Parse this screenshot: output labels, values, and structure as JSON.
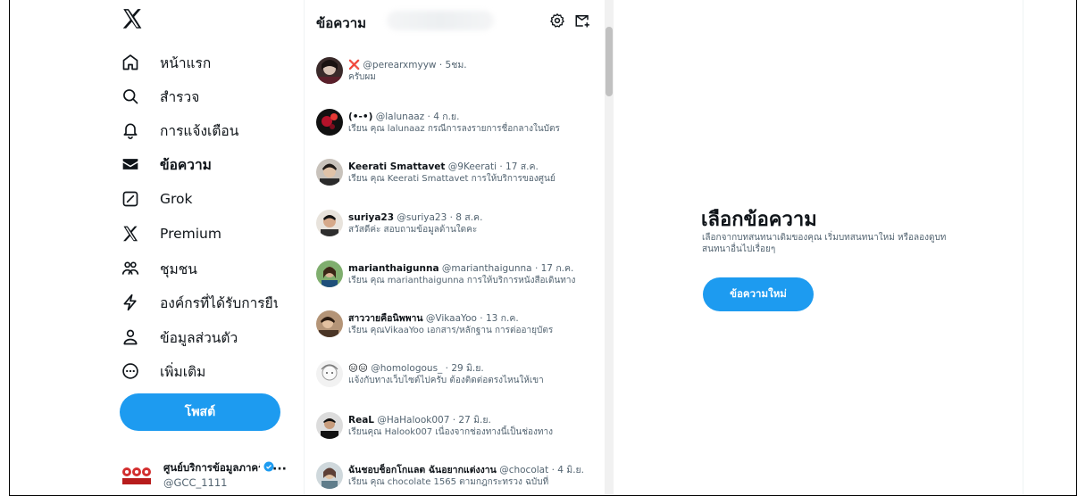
{
  "sidebar": {
    "logo": "x-logo-icon",
    "items": [
      {
        "label": "หน้าแรก",
        "icon": "home-icon"
      },
      {
        "label": "สำรวจ",
        "icon": "search-icon"
      },
      {
        "label": "การแจ้งเตือน",
        "icon": "bell-icon"
      },
      {
        "label": "ข้อความ",
        "icon": "envelope-icon",
        "active": true
      },
      {
        "label": "Grok",
        "icon": "grok-icon"
      },
      {
        "label": "Premium",
        "icon": "x-logo-icon"
      },
      {
        "label": "ชุมชน",
        "icon": "community-icon"
      },
      {
        "label": "องค์กรที่ได้รับการยืนยัน",
        "icon": "lightning-icon"
      },
      {
        "label": "ข้อมูลส่วนตัว",
        "icon": "profile-icon"
      },
      {
        "label": "เพิ่มเติม",
        "icon": "more-circle-icon"
      }
    ],
    "post_label": "โพสต์",
    "account": {
      "name": "ศูนย์บริการข้อมูลภาครัฐ",
      "handle": "@GCC_1111",
      "more": "···"
    }
  },
  "messages": {
    "title": "ข้อความ",
    "conversations": [
      {
        "name": "❌",
        "handle": "@perearxmyyw",
        "time": "5ชม.",
        "preview": "ครับผม"
      },
      {
        "name": "(•-•)",
        "handle": "@lalunaaz",
        "time": "4 ก.ย.",
        "preview": "เรียน คุณ lalunaaz กรณีการลงรายการชื่อกลางในบัตร"
      },
      {
        "name": "Keerati Smattavet",
        "handle": "@9Keerati",
        "time": "17 ส.ค.",
        "preview": "เรียน คุณ Keerati Smattavet การให้บริการของศูนย์"
      },
      {
        "name": "suriya23",
        "handle": "@suriya23",
        "time": "8 ส.ค.",
        "preview": "สวัสดีค่ะ สอบถามข้อมูลด้านใดคะ"
      },
      {
        "name": "marianthaigunna",
        "handle": "@marianthaigunna",
        "time": "17 ก.ค.",
        "preview": "เรียน คุณ marianthaigunna การให้บริการหนังสือเดินทาง"
      },
      {
        "name": "สาววายคือนิพพาน",
        "handle": "@VikaaYoo",
        "time": "13 ก.ค.",
        "preview": "เรียน คุณVikaaYoo เอกสาร/หลักฐาน การต่ออายุบัตร"
      },
      {
        "name": "😑😑",
        "handle": "@homologous_",
        "time": "29 มิ.ย.",
        "preview": "แจ้งกับทางเว็บไซต์ไปครับ ต้องติดต่อตรงไหนให้เขา"
      },
      {
        "name": "ReaL",
        "handle": "@HaHalook007",
        "time": "27 มิ.ย.",
        "preview": "เรียนคุณ Halook007 เนื่องจากช่องทางนี้เป็นช่องทาง"
      },
      {
        "name": "ฉันชอบช็อกโกแลต ฉันอยากแต่งงาน",
        "handle": "@chocolat",
        "time": "4 มิ.ย.",
        "preview": "เรียน คุณ chocolate 1565 ตามกฎกระทรวง ฉบับที่"
      }
    ]
  },
  "detail": {
    "title": "เลือกข้อความ",
    "description": "เลือกจากบทสนทนาเดิมของคุณ เริ่มบทสนทนาใหม่ หรือลองดูบทสนทนาอื่นไปเรื่อยๆ",
    "new_message_label": "ข้อความใหม่"
  },
  "colors": {
    "accent": "#1d9bf0",
    "secondary_text": "#536471",
    "primary_text": "#0f1419"
  }
}
